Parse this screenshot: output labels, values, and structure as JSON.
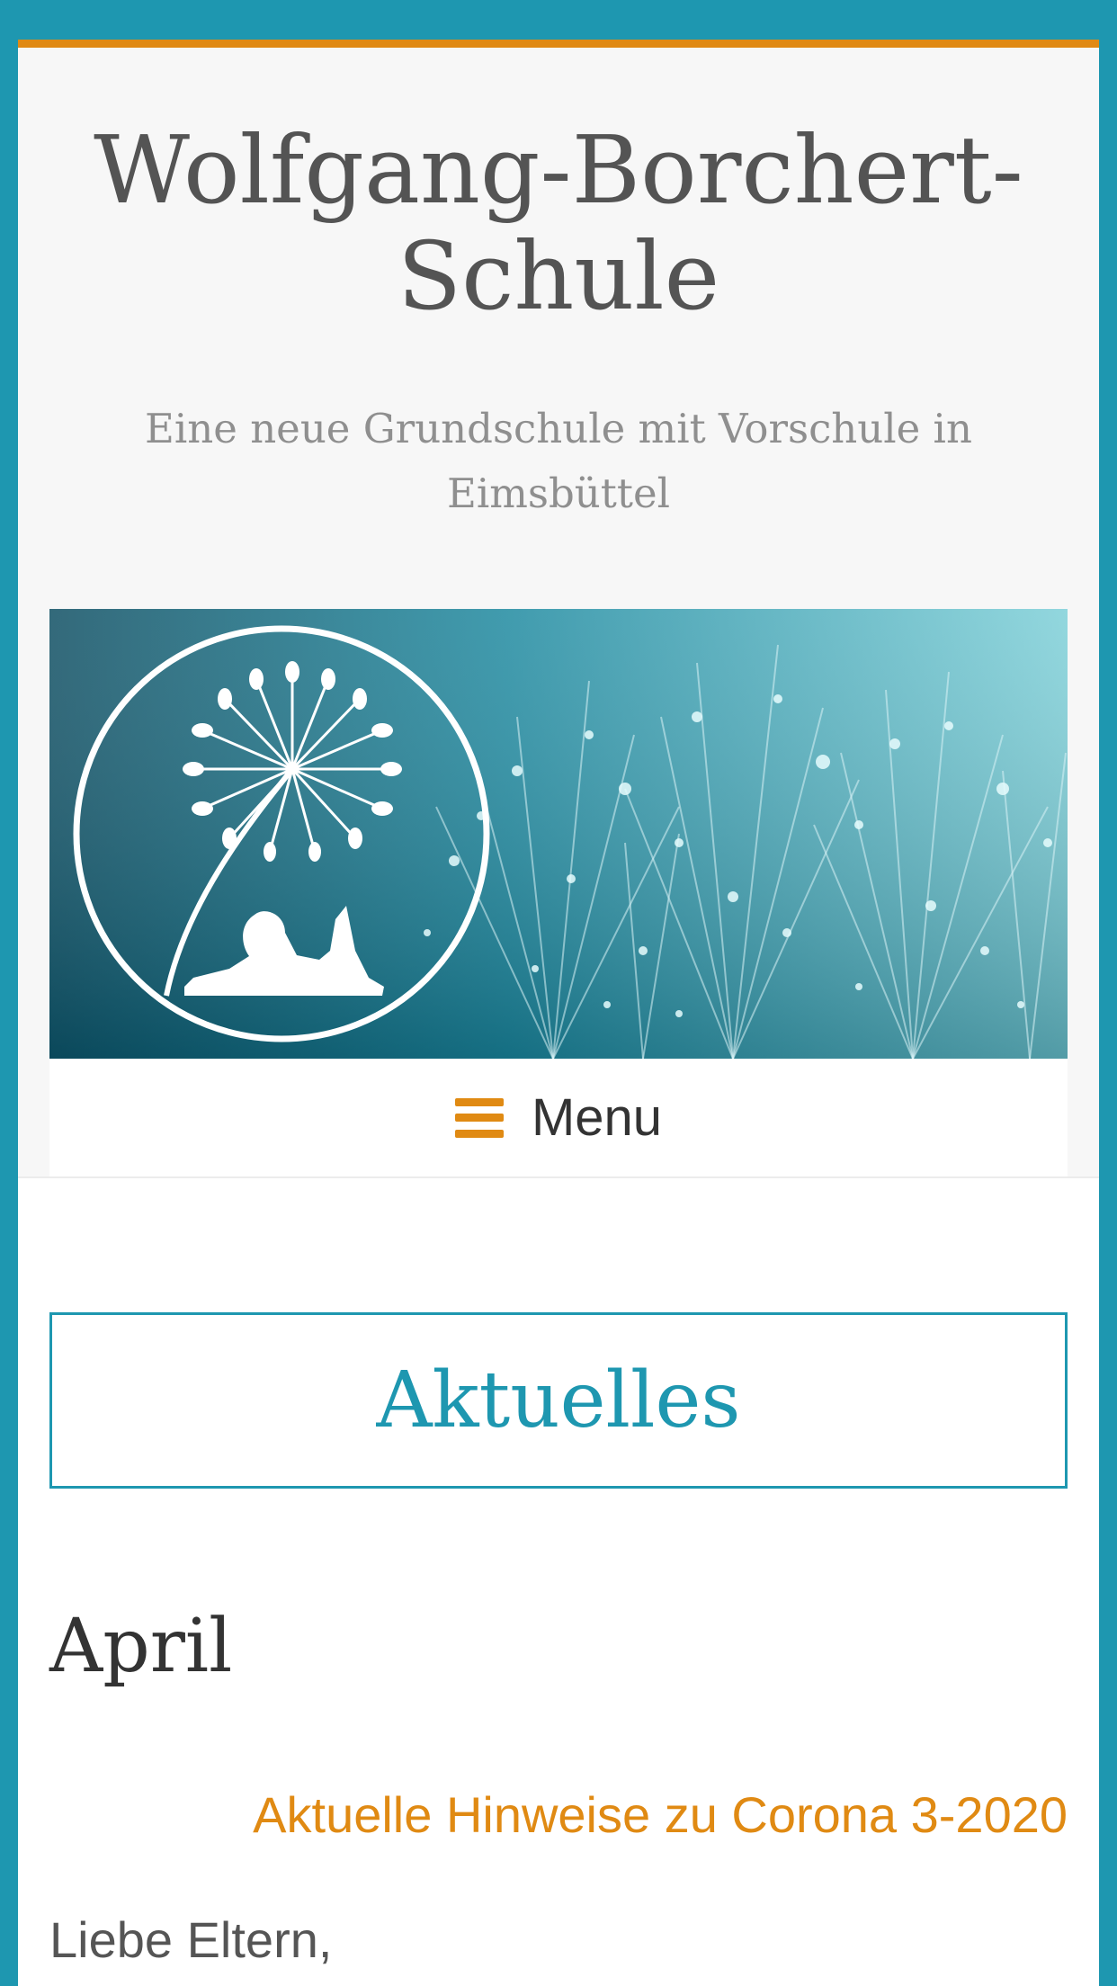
{
  "header": {
    "title": "Wolfgang-Borchert-Schule",
    "description": "Eine neue Grundschule mit Vorschule in Eimsbüttel"
  },
  "menu": {
    "icon": "hamburger-icon",
    "label": "Menu"
  },
  "section": {
    "title": "Aktuelles"
  },
  "content": {
    "month": "April",
    "post_link": "Aktuelle Hinweise zu Corona 3-2020",
    "greeting": "Liebe Eltern,"
  },
  "colors": {
    "frame": "#1e97b0",
    "accent": "#e08a13",
    "heading": "#1e97b0"
  }
}
